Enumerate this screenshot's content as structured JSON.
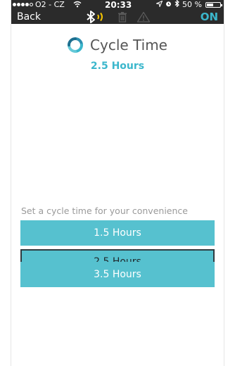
{
  "status_bar": {
    "carrier": "O2 - CZ",
    "time": "20:33",
    "battery": "50 %",
    "battery_level": 0.5
  },
  "nav": {
    "back_label": "Back",
    "power_label": "ON"
  },
  "header": {
    "title": "Cycle Time",
    "current_value": "2.5 Hours"
  },
  "options": {
    "hint": "Set a cycle time for your convenience",
    "items": [
      {
        "label": "1.5 Hours",
        "selected": false
      },
      {
        "label": "2.5 Hours",
        "selected": true
      },
      {
        "label": "3.5 Hours",
        "selected": false
      }
    ]
  },
  "colors": {
    "accent": "#3bb7cc",
    "button": "#56c1cf",
    "topbar": "#2b2b2b"
  }
}
